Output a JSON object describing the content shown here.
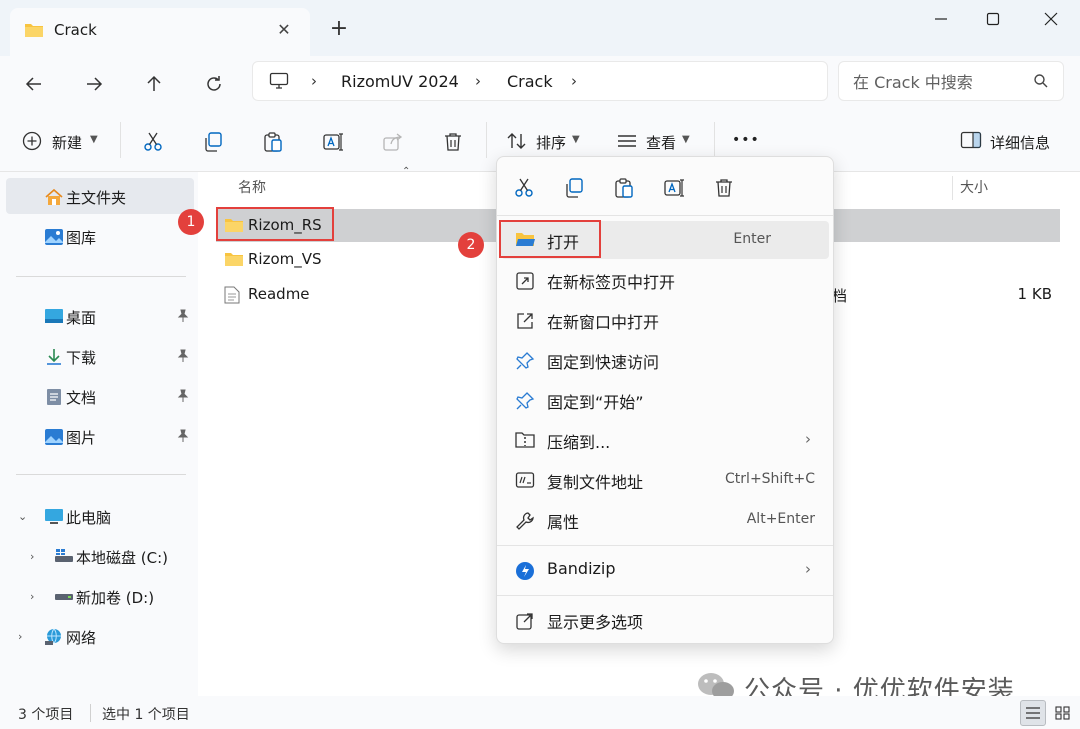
{
  "window": {
    "tab_title": "Crack",
    "colors": {
      "title_bg": "#eff4f9",
      "pane_bg": "#f9fafc",
      "folder": "#f8c440",
      "accent": "#0067c0",
      "highlight": "#e3403c"
    }
  },
  "address": {
    "crumbs": [
      "RizomUV 2024",
      "Crack"
    ],
    "search_placeholder": "在 Crack 中搜索"
  },
  "toolbar": {
    "new_label": "新建",
    "sort_label": "排序",
    "view_label": "查看",
    "more_label": "•••",
    "details_label": "详细信息"
  },
  "sidebar": {
    "home": "主文件夹",
    "gallery": "图库",
    "desktop": "桌面",
    "downloads": "下载",
    "documents": "文档",
    "pictures": "图片",
    "this_pc": "此电脑",
    "local_disk": "本地磁盘 (C:)",
    "new_volume": "新加卷 (D:)",
    "network": "网络"
  },
  "columns": {
    "name": "名称",
    "size": "大小"
  },
  "files": [
    {
      "name": "Rizom_RS",
      "type": "",
      "size": ""
    },
    {
      "name": "Rizom_VS",
      "type": "",
      "size": ""
    },
    {
      "name": "Readme",
      "type": "档",
      "size": "1 KB"
    }
  ],
  "badges": {
    "one": "1",
    "two": "2"
  },
  "context_menu": {
    "open": {
      "label": "打开",
      "shortcut": "Enter"
    },
    "open_new_tab": "在新标签页中打开",
    "open_new_window": "在新窗口中打开",
    "pin_quick": "固定到快速访问",
    "pin_start": "固定到“开始”",
    "compress": "压缩到...",
    "copy_path": {
      "label": "复制文件地址",
      "shortcut": "Ctrl+Shift+C"
    },
    "properties": {
      "label": "属性",
      "shortcut": "Alt+Enter"
    },
    "bandizip": "Bandizip",
    "more_options": "显示更多选项"
  },
  "status": {
    "count": "3 个项目",
    "selected": "选中 1 个项目"
  },
  "watermark": "公众号 · 优优软件安装"
}
